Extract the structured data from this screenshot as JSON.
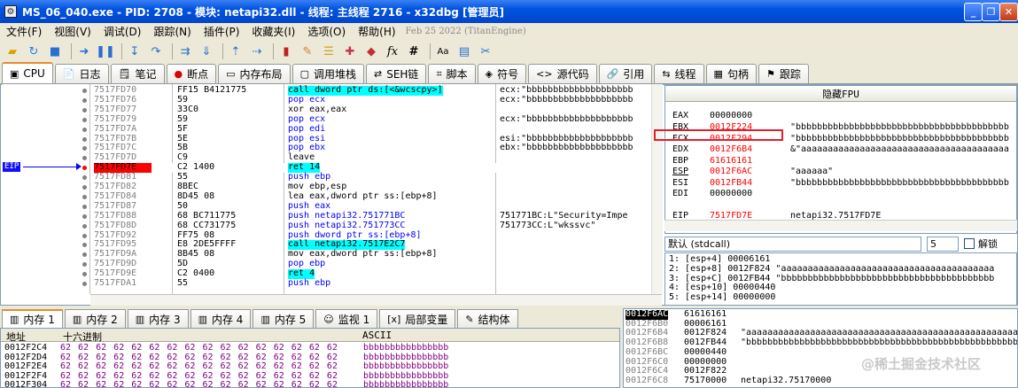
{
  "window": {
    "title": "MS_06_040.exe - PID: 2708 - 模块: netapi32.dll - 线程: 主线程 2716 - x32dbg [管理员]"
  },
  "menu": {
    "items": [
      "文件(F)",
      "视图(V)",
      "调试(D)",
      "跟踪(N)",
      "插件(P)",
      "收藏夹(I)",
      "选项(O)",
      "帮助(H)"
    ],
    "timestamp": "Feb 25 2022 (TitanEngine)"
  },
  "tabs": [
    {
      "label": "CPU",
      "icon": "cpu-icon"
    },
    {
      "label": "日志",
      "icon": "log-icon"
    },
    {
      "label": "笔记",
      "icon": "notes-icon"
    },
    {
      "label": "断点",
      "icon": "breakpoint-icon"
    },
    {
      "label": "内存布局",
      "icon": "memory-map-icon"
    },
    {
      "label": "调用堆栈",
      "icon": "callstack-icon"
    },
    {
      "label": "SEH链",
      "icon": "seh-icon"
    },
    {
      "label": "脚本",
      "icon": "script-icon"
    },
    {
      "label": "符号",
      "icon": "symbols-icon"
    },
    {
      "label": "源代码",
      "icon": "source-icon"
    },
    {
      "label": "引用",
      "icon": "references-icon"
    },
    {
      "label": "线程",
      "icon": "threads-icon"
    },
    {
      "label": "句柄",
      "icon": "handles-icon"
    },
    {
      "label": "跟踪",
      "icon": "trace-icon"
    }
  ],
  "eip_label": "EIP",
  "disasm": [
    {
      "addr": "7517FD70",
      "bytes": "FF15 B4121775",
      "ins": "call dword ptr ds:[<&wcscpy>]",
      "comment": "ecx:\"bbbbbbbbbbbbbbbbbbbb"
    },
    {
      "addr": "7517FD76",
      "bytes": "59",
      "ins": "pop ecx",
      "comment": "ecx:\"bbbbbbbbbbbbbbbbbbbb"
    },
    {
      "addr": "7517FD77",
      "bytes": "33C0",
      "ins": "xor eax,eax",
      "comment": ""
    },
    {
      "addr": "7517FD79",
      "bytes": "59",
      "ins": "pop ecx",
      "comment": "ecx:\"bbbbbbbbbbbbbbbbbbbb"
    },
    {
      "addr": "7517FD7A",
      "bytes": "5F",
      "ins": "pop edi",
      "comment": ""
    },
    {
      "addr": "7517FD7B",
      "bytes": "5E",
      "ins": "pop esi",
      "comment": "esi:\"bbbbbbbbbbbbbbbbbbbb"
    },
    {
      "addr": "7517FD7C",
      "bytes": "5B",
      "ins": "pop ebx",
      "comment": "ebx:\"bbbbbbbbbbbbbbbbbbbb"
    },
    {
      "addr": "7517FD7D",
      "bytes": "C9",
      "ins": "leave",
      "comment": ""
    },
    {
      "addr": "7517FD7E",
      "bytes": "C2 1400",
      "ins": "ret 14",
      "comment": ""
    },
    {
      "addr": "7517FD81",
      "bytes": "55",
      "ins": "push ebp",
      "comment": ""
    },
    {
      "addr": "7517FD82",
      "bytes": "8BEC",
      "ins": "mov ebp,esp",
      "comment": ""
    },
    {
      "addr": "7517FD84",
      "bytes": "8D45 08",
      "ins": "lea eax,dword ptr ss:[ebp+8]",
      "comment": ""
    },
    {
      "addr": "7517FD87",
      "bytes": "50",
      "ins": "push eax",
      "comment": ""
    },
    {
      "addr": "7517FD88",
      "bytes": "68 BC711775",
      "ins": "push netapi32.751771BC",
      "comment": "751771BC:L\"Security=Impe"
    },
    {
      "addr": "7517FD8D",
      "bytes": "68 CC731775",
      "ins": "push netapi32.751773CC",
      "comment": "751773CC:L\"wkssvc\""
    },
    {
      "addr": "7517FD92",
      "bytes": "FF75 08",
      "ins": "push dword ptr ss:[ebp+8]",
      "comment": ""
    },
    {
      "addr": "7517FD95",
      "bytes": "E8 2DE5FFFF",
      "ins": "call netapi32.7517E2C7",
      "comment": ""
    },
    {
      "addr": "7517FD9A",
      "bytes": "8B45 08",
      "ins": "mov eax,dword ptr ss:[ebp+8]",
      "comment": ""
    },
    {
      "addr": "7517FD9D",
      "bytes": "5D",
      "ins": "pop ebp",
      "comment": ""
    },
    {
      "addr": "7517FD9E",
      "bytes": "C2 0400",
      "ins": "ret 4",
      "comment": ""
    },
    {
      "addr": "7517FDA1",
      "bytes": "55",
      "ins": "push ebp",
      "comment": ""
    }
  ],
  "registers": {
    "title": "隐藏FPU",
    "rows": [
      {
        "name": "EAX",
        "value": "00000000",
        "desc": ""
      },
      {
        "name": "EBX",
        "value": "0012F224",
        "desc": "\"bbbbbbbbbbbbbbbbbbbbbbbbbbbbbbbbbbbbbbbb"
      },
      {
        "name": "ECX",
        "value": "0012F294",
        "desc": "\"bbbbbbbbbbbbbbbbbbbbbbbbbbbbbbbbbbbbbbbb"
      },
      {
        "name": "EDX",
        "value": "0012F6B4",
        "desc": "&\"aaaaaaaaaaaaaaaaaaaaaaaaaaaaaaaaaaaaaaa"
      },
      {
        "name": "EBP",
        "value": "61616161",
        "desc": ""
      },
      {
        "name": "ESP",
        "value": "0012F6AC",
        "desc": "\"aaaaaa\""
      },
      {
        "name": "ESI",
        "value": "0012FB44",
        "desc": "\"bbbbbbbbbbbbbbbbbbbbbbbbbbbbbbbbbbbbbbbb"
      },
      {
        "name": "EDI",
        "value": "00000000",
        "desc": ""
      },
      {
        "name": "EIP",
        "value": "7517FD7E",
        "desc": "netapi32.7517FD7E"
      }
    ]
  },
  "callconv": {
    "value": "默认 (stdcall)",
    "count": "5",
    "unlock_label": "解锁"
  },
  "stack_args": [
    "1: [esp+4] 00006161",
    "2: [esp+8] 0012F824 \"aaaaaaaaaaaaaaaaaaaaaaaaaaaaaaaaaaaaaaaa",
    "3: [esp+C] 0012FB44 \"bbbbbbbbbbbbbbbbbbbbbbbbbbbbbbbbbbbbbbbb",
    "4: [esp+10] 00000440",
    "5: [esp+14] 00000000"
  ],
  "bottom_tabs": [
    {
      "label": "内存 1",
      "icon": "dump-icon"
    },
    {
      "label": "内存 2",
      "icon": "dump-icon"
    },
    {
      "label": "内存 3",
      "icon": "dump-icon"
    },
    {
      "label": "内存 4",
      "icon": "dump-icon"
    },
    {
      "label": "内存 5",
      "icon": "dump-icon"
    },
    {
      "label": "监视 1",
      "icon": "watch-icon"
    },
    {
      "label": "局部变量",
      "icon": "locals-icon"
    },
    {
      "label": "结构体",
      "icon": "struct-icon"
    }
  ],
  "dump": {
    "headers": {
      "addr": "地址",
      "hex": "十六进制",
      "ascii": "ASCII"
    },
    "rows": [
      {
        "addr": "0012F2C4",
        "hex": "62 62 62 62 62 62 62 62 62 62 62 62 62 62 62 62",
        "ascii": "bbbbbbbbbbbbbbbb"
      },
      {
        "addr": "0012F2D4",
        "hex": "62 62 62 62 62 62 62 62 62 62 62 62 62 62 62 62",
        "ascii": "bbbbbbbbbbbbbbbb"
      },
      {
        "addr": "0012F2E4",
        "hex": "62 62 62 62 62 62 62 62 62 62 62 62 62 62 62 62",
        "ascii": "bbbbbbbbbbbbbbbb"
      },
      {
        "addr": "0012F2F4",
        "hex": "62 62 62 62 62 62 62 62 62 62 62 62 62 62 62 62",
        "ascii": "bbbbbbbbbbbbbbbb"
      },
      {
        "addr": "0012F304",
        "hex": "62 62 62 62 62 62 62 62 62 62 62 62 62 62 62 62",
        "ascii": "bbbbbbbbbbbbbbbb"
      }
    ]
  },
  "stack": [
    {
      "addr": "0012F6AC",
      "value": "61616161",
      "comment": ""
    },
    {
      "addr": "0012F6B0",
      "value": "00006161",
      "comment": ""
    },
    {
      "addr": "0012F6B4",
      "value": "0012F824",
      "comment": "\"aaaaaaaaaaaaaaaaaaaaaaaaaaaaaaaaaaaaaaaaaaaaaaaaaaaaaaa"
    },
    {
      "addr": "0012F6B8",
      "value": "0012FB44",
      "comment": "\"bbbbbbbbbbbbbbbbbbbbbbbbbbbbbbbbbbbbbbbbbbbbbbbbbbbbbbb"
    },
    {
      "addr": "0012F6BC",
      "value": "00000440",
      "comment": ""
    },
    {
      "addr": "0012F6C0",
      "value": "00000000",
      "comment": ""
    },
    {
      "addr": "0012F6C4",
      "value": "0012F822",
      "comment": ""
    },
    {
      "addr": "0012F6C8",
      "value": "75170000",
      "comment": "netapi32.75170000"
    }
  ],
  "watermark": "@稀土掘金技术社区",
  "eip_index": 8
}
